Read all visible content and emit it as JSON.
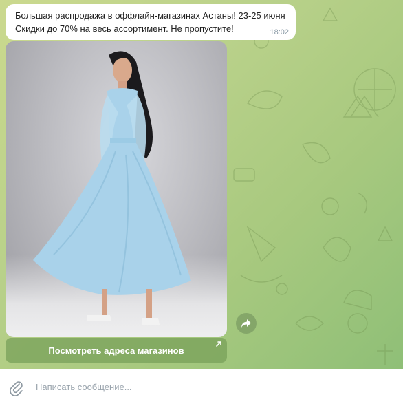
{
  "message": {
    "text": "Большая распродажа в оффлайн-магазинах Астаны! 23-25 июня\nСкидки до 70% на весь ассортимент. Не пропустите!",
    "time": "18:02"
  },
  "photo": {
    "alt_icon": "photo-woman-blue-dress",
    "dress_color": "#a9d2ea"
  },
  "link_button": {
    "label": "Посмотреть адреса магазинов",
    "icon": "external-link-arrow-icon"
  },
  "share": {
    "icon": "share-arrow-icon"
  },
  "composer": {
    "placeholder": "Написать сообщение...",
    "attach_icon": "paperclip-icon"
  },
  "colors": {
    "chat_background": "#b9d18a",
    "bubble": "#ffffff",
    "button": "#78a05a"
  }
}
